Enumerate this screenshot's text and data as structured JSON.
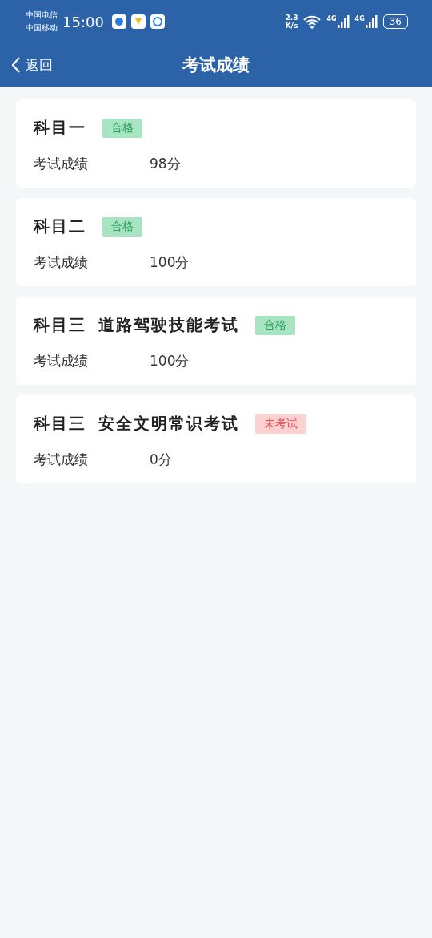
{
  "status_bar": {
    "carriers": [
      "中国电信",
      "中国移动"
    ],
    "time": "15:00",
    "speed": [
      "2.3",
      "K/s"
    ],
    "network_labels": [
      "4G",
      "4G"
    ],
    "battery": "36"
  },
  "header": {
    "back": "返回",
    "title": "考试成绩"
  },
  "subjects": [
    {
      "title": "科目一",
      "badge": {
        "kind": "passed",
        "text": "合格"
      },
      "label": "考试成绩",
      "score": "98分"
    },
    {
      "title": "科目二",
      "badge": {
        "kind": "passed",
        "text": "合格"
      },
      "label": "考试成绩",
      "score": "100分"
    },
    {
      "title": "科目三 道路驾驶技能考试",
      "badge": {
        "kind": "passed",
        "text": "合格"
      },
      "label": "考试成绩",
      "score": "100分"
    },
    {
      "title": "科目三 安全文明常识考试",
      "badge": {
        "kind": "failed",
        "text": "未考试"
      },
      "label": "考试成绩",
      "score": "0分"
    }
  ]
}
